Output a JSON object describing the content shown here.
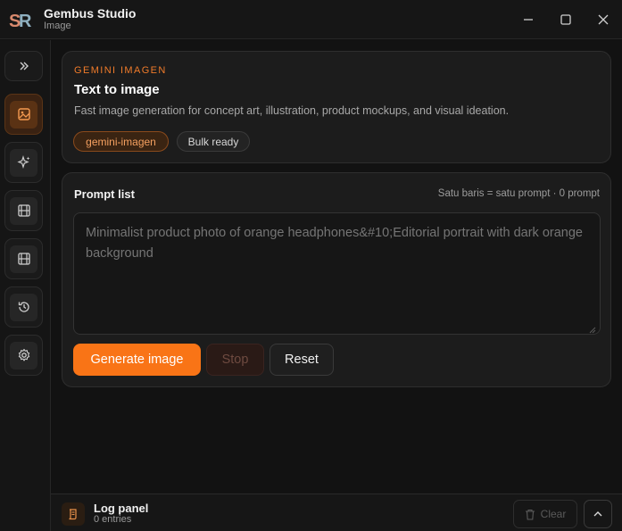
{
  "window": {
    "title": "Gembus Studio",
    "subtitle": "Image",
    "logo_text": "SR"
  },
  "sidebar": {
    "items": [
      {
        "icon": "expand-icon"
      },
      {
        "icon": "image-icon",
        "active": true
      },
      {
        "icon": "sparkles-icon"
      },
      {
        "icon": "film-icon"
      },
      {
        "icon": "film-icon"
      },
      {
        "icon": "history-icon"
      },
      {
        "icon": "gear-icon"
      }
    ]
  },
  "model_card": {
    "eyebrow": "GEMINI IMAGEN",
    "title": "Text to image",
    "description": "Fast image generation for concept art, illustration, product mockups, and visual ideation.",
    "chips": [
      "gemini-imagen",
      "Bulk ready"
    ]
  },
  "prompt_card": {
    "title": "Prompt list",
    "hint": "Satu baris = satu prompt · 0 prompt",
    "placeholder": "Minimalist product photo of orange headphones&#10;Editorial portrait with dark orange background",
    "value": "",
    "buttons": {
      "generate": "Generate image",
      "stop": "Stop",
      "reset": "Reset"
    }
  },
  "log_panel": {
    "title": "Log panel",
    "entries": "0 entries",
    "clear_label": "Clear"
  },
  "colors": {
    "accent": "#f97416",
    "background": "#121212",
    "card": "#1c1c1c"
  }
}
